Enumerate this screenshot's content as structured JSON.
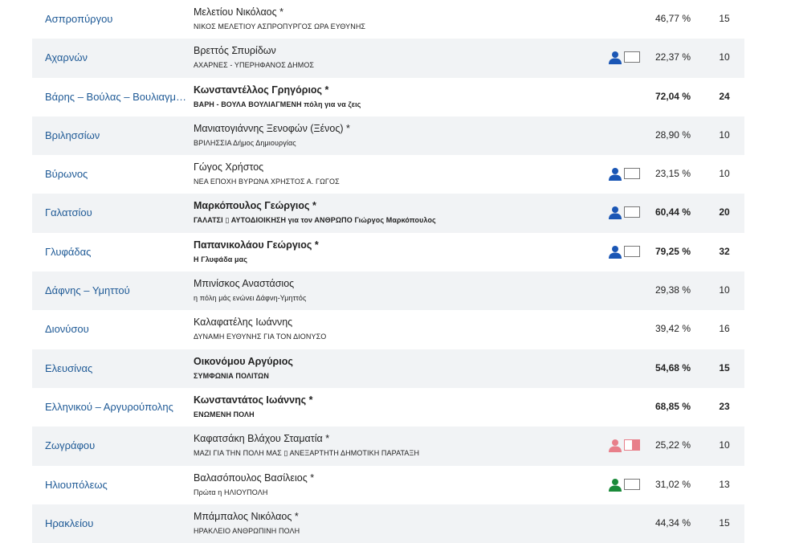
{
  "colors": {
    "link": "#1f5a96",
    "row_alt": "#f1f3f5",
    "icon_blue": "#1a56b5",
    "icon_pink": "#e87f8a",
    "icon_green": "#1a8a3a"
  },
  "rows": [
    {
      "municipality": "Ασπροπύργου",
      "candidate": "Μελετίου Νικόλαος *",
      "combination": "ΝΙΚΟΣ ΜΕΛΕΤΙΟΥ ΑΣΠΡΟΠΥΡΓΟΣ ΩΡΑ ΕΥΘΥΝΗΣ",
      "percent": "46,77 %",
      "seats": "15",
      "elected": false,
      "icon": "none"
    },
    {
      "municipality": "Αχαρνών",
      "candidate": "Βρεττός Σπυρίδων",
      "combination": "ΑΧΑΡΝΕΣ - ΥΠΕΡΗΦΑΝΟΣ ΔΗΜΟΣ",
      "percent": "22,37 %",
      "seats": "10",
      "elected": false,
      "icon": "blue"
    },
    {
      "municipality": "Βάρης – Βούλας – Βουλιαγμένης",
      "candidate": "Κωνσταντέλλος Γρηγόριος *",
      "combination": "ΒΑΡΗ - ΒΟΥΛΑ ΒΟΥΛΙΑΓΜΕΝΗ πόλη για να ζεις",
      "percent": "72,04 %",
      "seats": "24",
      "elected": true,
      "icon": "none"
    },
    {
      "municipality": "Βριλησσίων",
      "candidate": "Μανιατογιάννης Ξενοφών (Ξένος) *",
      "combination": "ΒΡΙΛΗΣΣΙΑ Δήμος Δημιουργίας",
      "percent": "28,90 %",
      "seats": "10",
      "elected": false,
      "icon": "none"
    },
    {
      "municipality": "Βύρωνος",
      "candidate": "Γώγος Χρήστος",
      "combination": "ΝΕΑ ΕΠΟΧΗ ΒΥΡΩΝΑ ΧΡΗΣΤΟΣ Α. ΓΩΓΟΣ",
      "percent": "23,15 %",
      "seats": "10",
      "elected": false,
      "icon": "blue"
    },
    {
      "municipality": "Γαλατσίου",
      "candidate": "Μαρκόπουλος Γεώργιος *",
      "combination": "ΓΑΛΑΤΣΙ ▯ ΑΥΤΟΔΙΟΙΚΗΣΗ για τον ΑΝΘΡΩΠΟ Γιώργος Μαρκόπουλος",
      "percent": "60,44 %",
      "seats": "20",
      "elected": true,
      "icon": "blue"
    },
    {
      "municipality": "Γλυφάδας",
      "candidate": "Παπανικολάου Γεώργιος *",
      "combination": "Η Γλυφάδα μας",
      "percent": "79,25 %",
      "seats": "32",
      "elected": true,
      "icon": "blue"
    },
    {
      "municipality": "Δάφνης – Υμηττού",
      "candidate": "Μπινίσκος Αναστάσιος",
      "combination": "η πόλη μάς ενώνει Δάφνη-Υμηττός",
      "percent": "29,38 %",
      "seats": "10",
      "elected": false,
      "icon": "none"
    },
    {
      "municipality": "Διονύσου",
      "candidate": "Καλαφατέλης Ιωάννης",
      "combination": "ΔΥΝΑΜΗ ΕΥΘΥΝΗΣ ΓΙΑ ΤΟΝ ΔΙΟΝΥΣΟ",
      "percent": "39,42 %",
      "seats": "16",
      "elected": false,
      "icon": "none"
    },
    {
      "municipality": "Ελευσίνας",
      "candidate": "Οικονόμου Αργύριος",
      "combination": "ΣΥΜΦΩΝΙΑ ΠΟΛΙΤΩΝ",
      "percent": "54,68 %",
      "seats": "15",
      "elected": true,
      "icon": "none"
    },
    {
      "municipality": "Ελληνικού – Αργυρούπολης",
      "candidate": "Κωνσταντάτος Ιωάννης *",
      "combination": "ΕΝΩΜΕΝΗ ΠΟΛΗ",
      "percent": "68,85 %",
      "seats": "23",
      "elected": true,
      "icon": "none"
    },
    {
      "municipality": "Ζωγράφου",
      "candidate": "Καφατσάκη Βλάχου Σταματία *",
      "combination": "ΜΑΖΙ ΓΙΑ ΤΗΝ ΠΟΛΗ ΜΑΣ ▯ ΑΝΕΞΑΡΤΗΤΗ ΔΗΜΟΤΙΚΗ ΠΑΡΑΤΑΞΗ",
      "percent": "25,22 %",
      "seats": "10",
      "elected": false,
      "icon": "pink"
    },
    {
      "municipality": "Ηλιουπόλεως",
      "candidate": "Βαλασόπουλος Βασίλειος *",
      "combination": "Πρώτα η ΗΛΙΟΥΠΟΛΗ",
      "percent": "31,02 %",
      "seats": "13",
      "elected": false,
      "icon": "green"
    },
    {
      "municipality": "Ηρακλείου",
      "candidate": "Μπάμπαλος Νικόλαος *",
      "combination": "ΗΡΑΚΛΕΙΟ ΑΝΘΡΩΠΙΝΗ ΠΟΛΗ",
      "percent": "44,34 %",
      "seats": "15",
      "elected": false,
      "icon": "none"
    }
  ]
}
